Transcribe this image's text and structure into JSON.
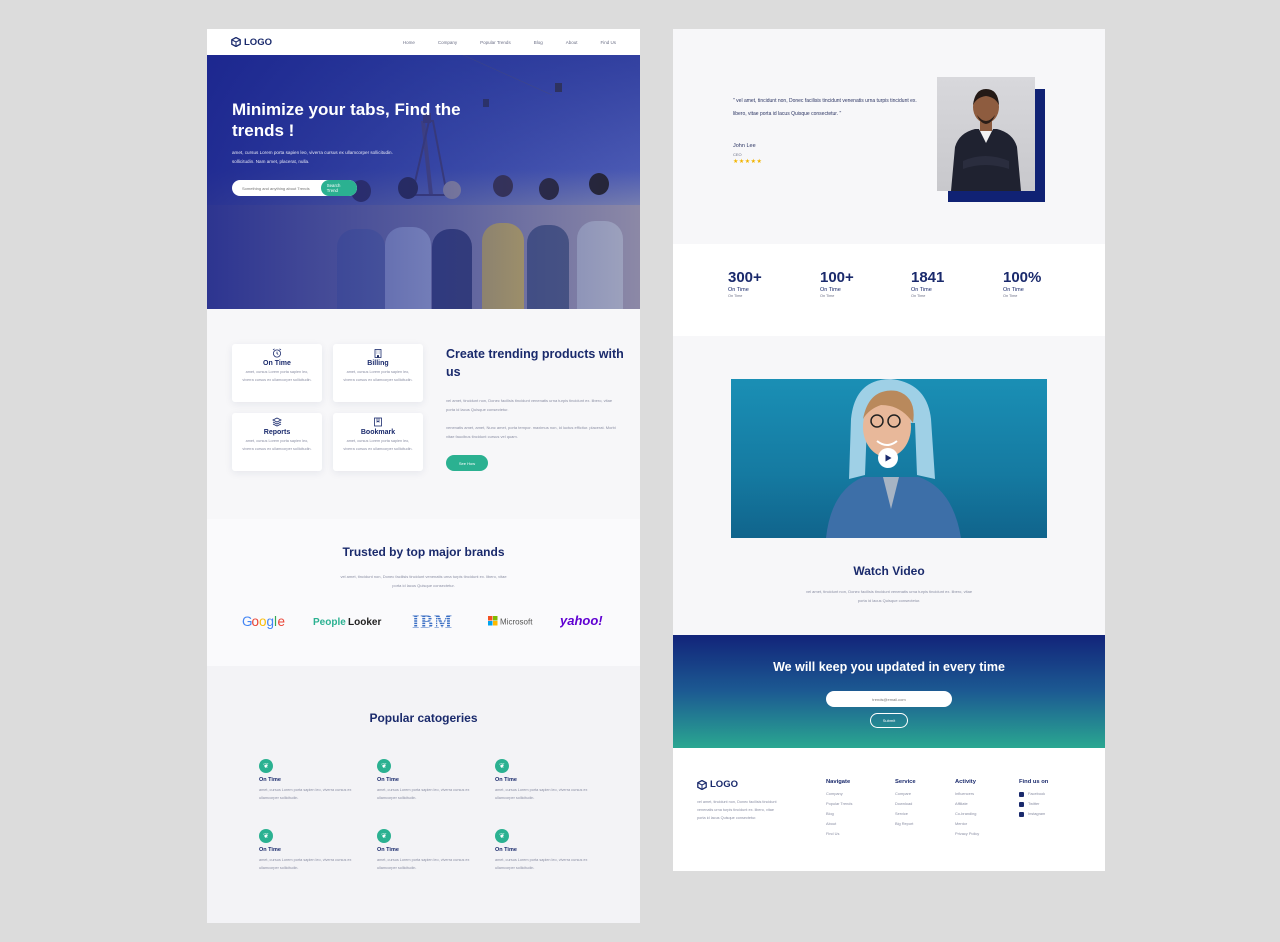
{
  "nav": {
    "logo": "LOGO",
    "links": [
      "Home",
      "Company",
      "Popular Trends",
      "Blog",
      "About",
      "Find Us"
    ]
  },
  "hero": {
    "title": "Minimize your tabs, Find the trends !",
    "subtitle": "amet, cursus Lorem porta sapien leo, viverra cursus ex ullamcorper sollicitudin. sollicitudin. Nam amet, placerat, nulla.",
    "search_placeholder": "Something and anything about Trends",
    "search_button": "Search Trend"
  },
  "features": {
    "cards": [
      {
        "title": "On Time",
        "desc": "amet, cursus Lorem porta sapien leo, viverra cursus ex ullamcorper sollicitudin.",
        "icon": "alarm-clock-icon"
      },
      {
        "title": "Billing",
        "desc": "amet, cursus Lorem porta sapien leo, viverra cursus ex ullamcorper sollicitudin.",
        "icon": "building-icon"
      },
      {
        "title": "Reports",
        "desc": "amet, cursus Lorem porta sapien leo, viverra cursus ex ullamcorper sollicitudin.",
        "icon": "layers-icon"
      },
      {
        "title": "Bookmark",
        "desc": "amet, cursus Lorem porta sapien leo, viverra cursus ex ullamcorper sollicitudin.",
        "icon": "bookmark-icon"
      }
    ],
    "title": "Create trending products with us",
    "p1": "vel amet, tincidunt non, Donec facilisis tincidunt venenatis urna turpis tincidunt ex. libero, vitae porta id lacus Quisque consectetur.",
    "p2": "venenatis amet, amet, Nunc amet, porta tempor. maximus non, id luctus efficitur. placerat. Morbi vitae faucibus tincidunt cursus vel quam.",
    "button": "See How"
  },
  "brands": {
    "title": "Trusted by top major brands",
    "desc": "vel amet, tincidunt non, Donec facilisis tincidunt venenatis urna turpis tincidunt ex. libero, vitae porta id lacus Quisque consectetur.",
    "logos": [
      "Google",
      "PeopleLooker",
      "IBM",
      "Microsoft",
      "yahoo!"
    ]
  },
  "categories": {
    "title": "Popular catogeries",
    "items": [
      {
        "title": "On Time",
        "desc": "amet, cursus Lorem porta sapien leo, viverra cursus ex ullamcorper sollicitudin."
      },
      {
        "title": "On Time",
        "desc": "amet, cursus Lorem porta sapien leo, viverra cursus ex ullamcorper sollicitudin."
      },
      {
        "title": "On Time",
        "desc": "amet, cursus Lorem porta sapien leo, viverra cursus ex ullamcorper sollicitudin."
      },
      {
        "title": "On Time",
        "desc": "amet, cursus Lorem porta sapien leo, viverra cursus ex ullamcorper sollicitudin."
      },
      {
        "title": "On Time",
        "desc": "amet, cursus Lorem porta sapien leo, viverra cursus ex ullamcorper sollicitudin."
      },
      {
        "title": "On Time",
        "desc": "amet, cursus Lorem porta sapien leo, viverra cursus ex ullamcorper sollicitudin."
      }
    ]
  },
  "testimonial": {
    "quote": "\" vel amet, tincidunt non, Donec facilisis tincidunt venenatis urna turpis tincidunt ex. libero, vitae porta id lacus Quisque consectetur. \"",
    "name": "John Lee",
    "role": "CEO",
    "stars": "★★★★★",
    "rating": 5
  },
  "stats": [
    {
      "num": "300+",
      "label": "On Time",
      "sub": "On Time"
    },
    {
      "num": "100+",
      "label": "On Time",
      "sub": "On Time"
    },
    {
      "num": "1841",
      "label": "On Time",
      "sub": "On Time"
    },
    {
      "num": "100%",
      "label": "On Time",
      "sub": "On Time"
    }
  ],
  "video": {
    "title": "Watch Video",
    "desc": "vel amet, tincidunt non, Donec facilisis tincidunt venenatis urna turpis tincidunt ex. libero, vitae porta id lacus Quisque consectetur."
  },
  "newsletter": {
    "title": "We will keep you updated in every time",
    "placeholder": "trends@email.com",
    "button": "Submit"
  },
  "footer": {
    "logo": "LOGO",
    "desc": "vel amet, tincidunt non, Donec facilisis tincidunt venenatis urna turpis tincidunt ex. libero, vitae porta id lacus Quisque consectetur.",
    "columns": [
      {
        "heading": "Navigate",
        "items": [
          "Company",
          "Popular Trends",
          "Blog",
          "About",
          "Find Us"
        ]
      },
      {
        "heading": "Service",
        "items": [
          "Compare",
          "Download",
          "Service",
          "Big Report"
        ]
      },
      {
        "heading": "Activity",
        "items": [
          "Influencers",
          "Affiliate",
          "Co-branding",
          "Mentor",
          "Privacy Policy"
        ]
      }
    ],
    "social": {
      "heading": "Find us on",
      "items": [
        "Facebook",
        "Twitter",
        "Instagram"
      ]
    }
  },
  "colors": {
    "navy": "#1a2a6c",
    "accent": "#2bb191"
  }
}
